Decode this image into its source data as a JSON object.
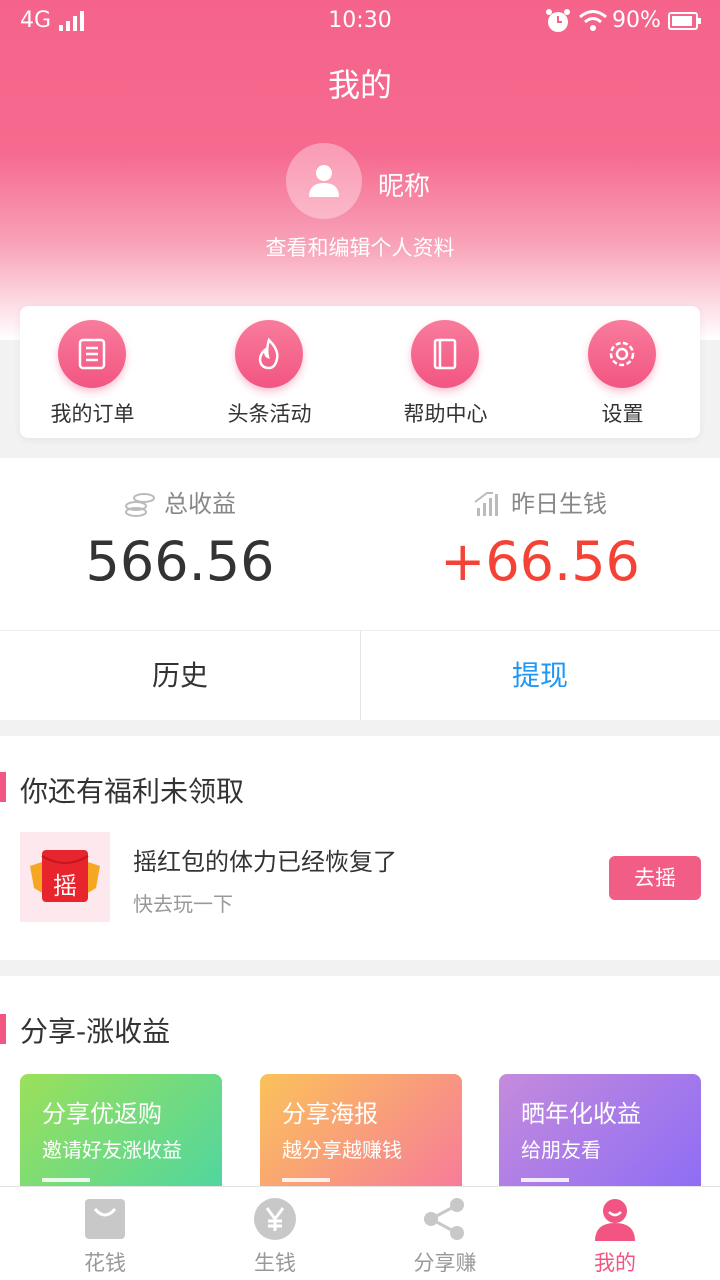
{
  "status_bar": {
    "network": "4G",
    "time": "10:30",
    "battery": "90%"
  },
  "header": {
    "title": "我的",
    "nickname": "昵称",
    "profile_link": "查看和编辑个人资料"
  },
  "menu": [
    {
      "label": "我的订单",
      "icon": "order-icon"
    },
    {
      "label": "头条活动",
      "icon": "flame-icon"
    },
    {
      "label": "帮助中心",
      "icon": "book-icon"
    },
    {
      "label": "设置",
      "icon": "gear-icon"
    }
  ],
  "earnings": {
    "total_label": "总收益",
    "total_value": "566.56",
    "yesterday_label": "昨日生钱",
    "yesterday_value": "+66.56"
  },
  "actions": {
    "history": "历史",
    "withdraw": "提现"
  },
  "rewards": {
    "title": "你还有福利未领取",
    "item_title": "摇红包的体力已经恢复了",
    "item_sub": "快去玩一下",
    "button": "去摇",
    "thumb_char": "摇"
  },
  "share": {
    "title": "分享-涨收益",
    "cards": [
      {
        "title": "分享优返购",
        "subtitle": "邀请好友涨收益"
      },
      {
        "title": "分享海报",
        "subtitle": "越分享越赚钱"
      },
      {
        "title": "晒年化收益",
        "subtitle": "给朋友看"
      }
    ]
  },
  "tabs": [
    {
      "label": "花钱",
      "icon": "shopping-bag-icon"
    },
    {
      "label": "生钱",
      "icon": "yen-icon"
    },
    {
      "label": "分享赚",
      "icon": "share-icon"
    },
    {
      "label": "我的",
      "icon": "profile-icon",
      "active": true
    }
  ],
  "colors": {
    "brand": "#f25581",
    "accent_red": "#f44336",
    "link_blue": "#2196f3",
    "inactive": "#bbbbbb"
  }
}
